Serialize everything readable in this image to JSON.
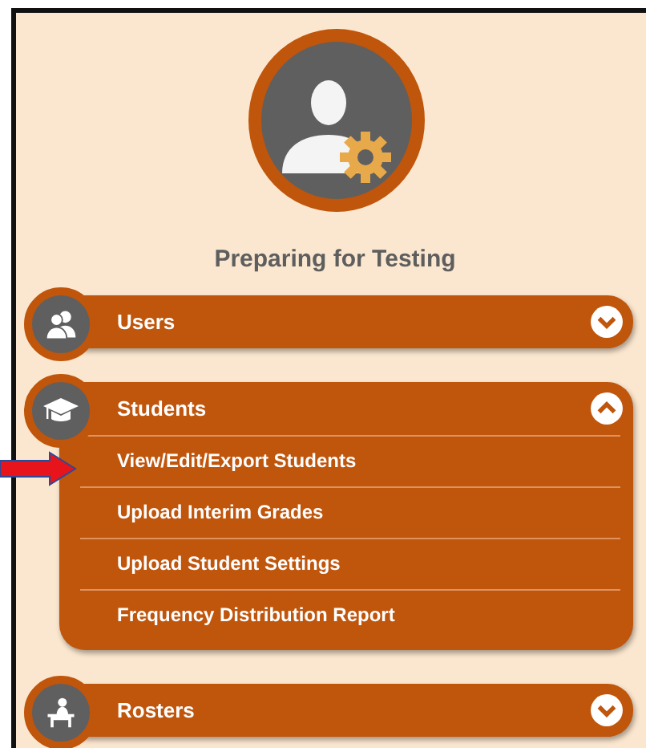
{
  "title": "Preparing for Testing",
  "sections": [
    {
      "kind": "users",
      "label": "Users",
      "expanded": false
    },
    {
      "kind": "students",
      "label": "Students",
      "expanded": true,
      "items": [
        {
          "label": "View/Edit/Export Students"
        },
        {
          "label": "Upload Interim Grades"
        },
        {
          "label": "Upload Student Settings"
        },
        {
          "label": "Frequency Distribution Report"
        }
      ]
    },
    {
      "kind": "rosters",
      "label": "Rosters",
      "expanded": false
    }
  ]
}
